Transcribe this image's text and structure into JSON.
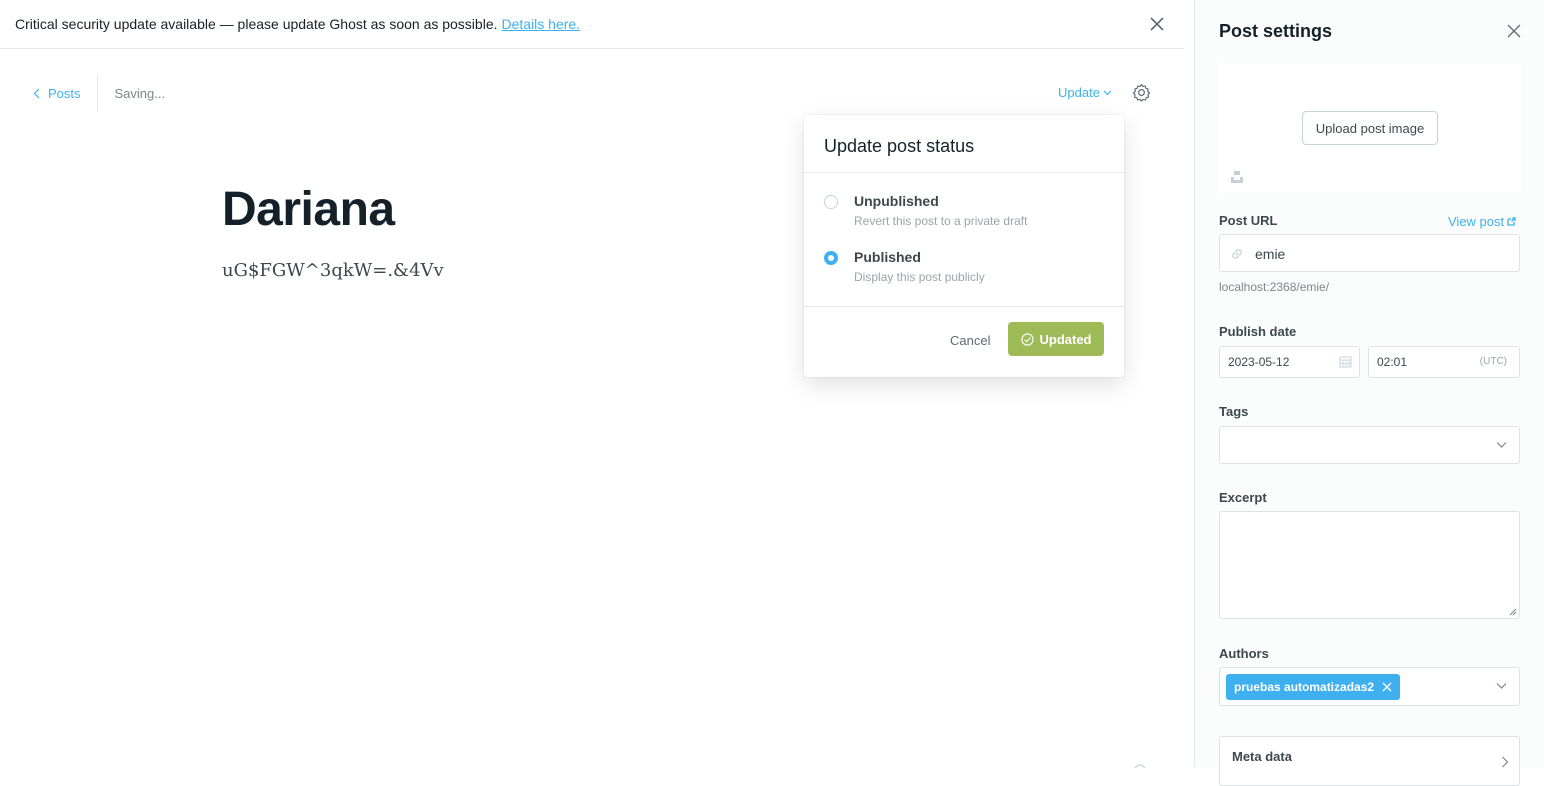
{
  "banner": {
    "message": "Critical security update available — please update Ghost as soon as possible.",
    "link": "Details here."
  },
  "editor": {
    "back_label": "Posts",
    "status_text": "Saving...",
    "update_label": "Update",
    "title": "Dariana",
    "body": "uG$FGW^3qkW=.&4Vv"
  },
  "publish_menu": {
    "title": "Update post status",
    "options": [
      {
        "label": "Unpublished",
        "description": "Revert this post to a private draft",
        "selected": false
      },
      {
        "label": "Published",
        "description": "Display this post publicly",
        "selected": true
      }
    ],
    "cancel_label": "Cancel",
    "confirm_label": "Updated"
  },
  "settings": {
    "title": "Post settings",
    "upload_label": "Upload post image",
    "post_url_label": "Post URL",
    "view_post_label": "View post",
    "slug": "emie",
    "url_hint": "localhost:2368/emie/",
    "publish_date_label": "Publish date",
    "date": "2023-05-12",
    "time": "02:01",
    "timezone": "(UTC)",
    "tags_label": "Tags",
    "excerpt_label": "Excerpt",
    "authors_label": "Authors",
    "author": "pruebas automatizadas2",
    "meta_label": "Meta data"
  },
  "colors": {
    "accent": "#3eb0ef",
    "success": "#9fbb58"
  }
}
